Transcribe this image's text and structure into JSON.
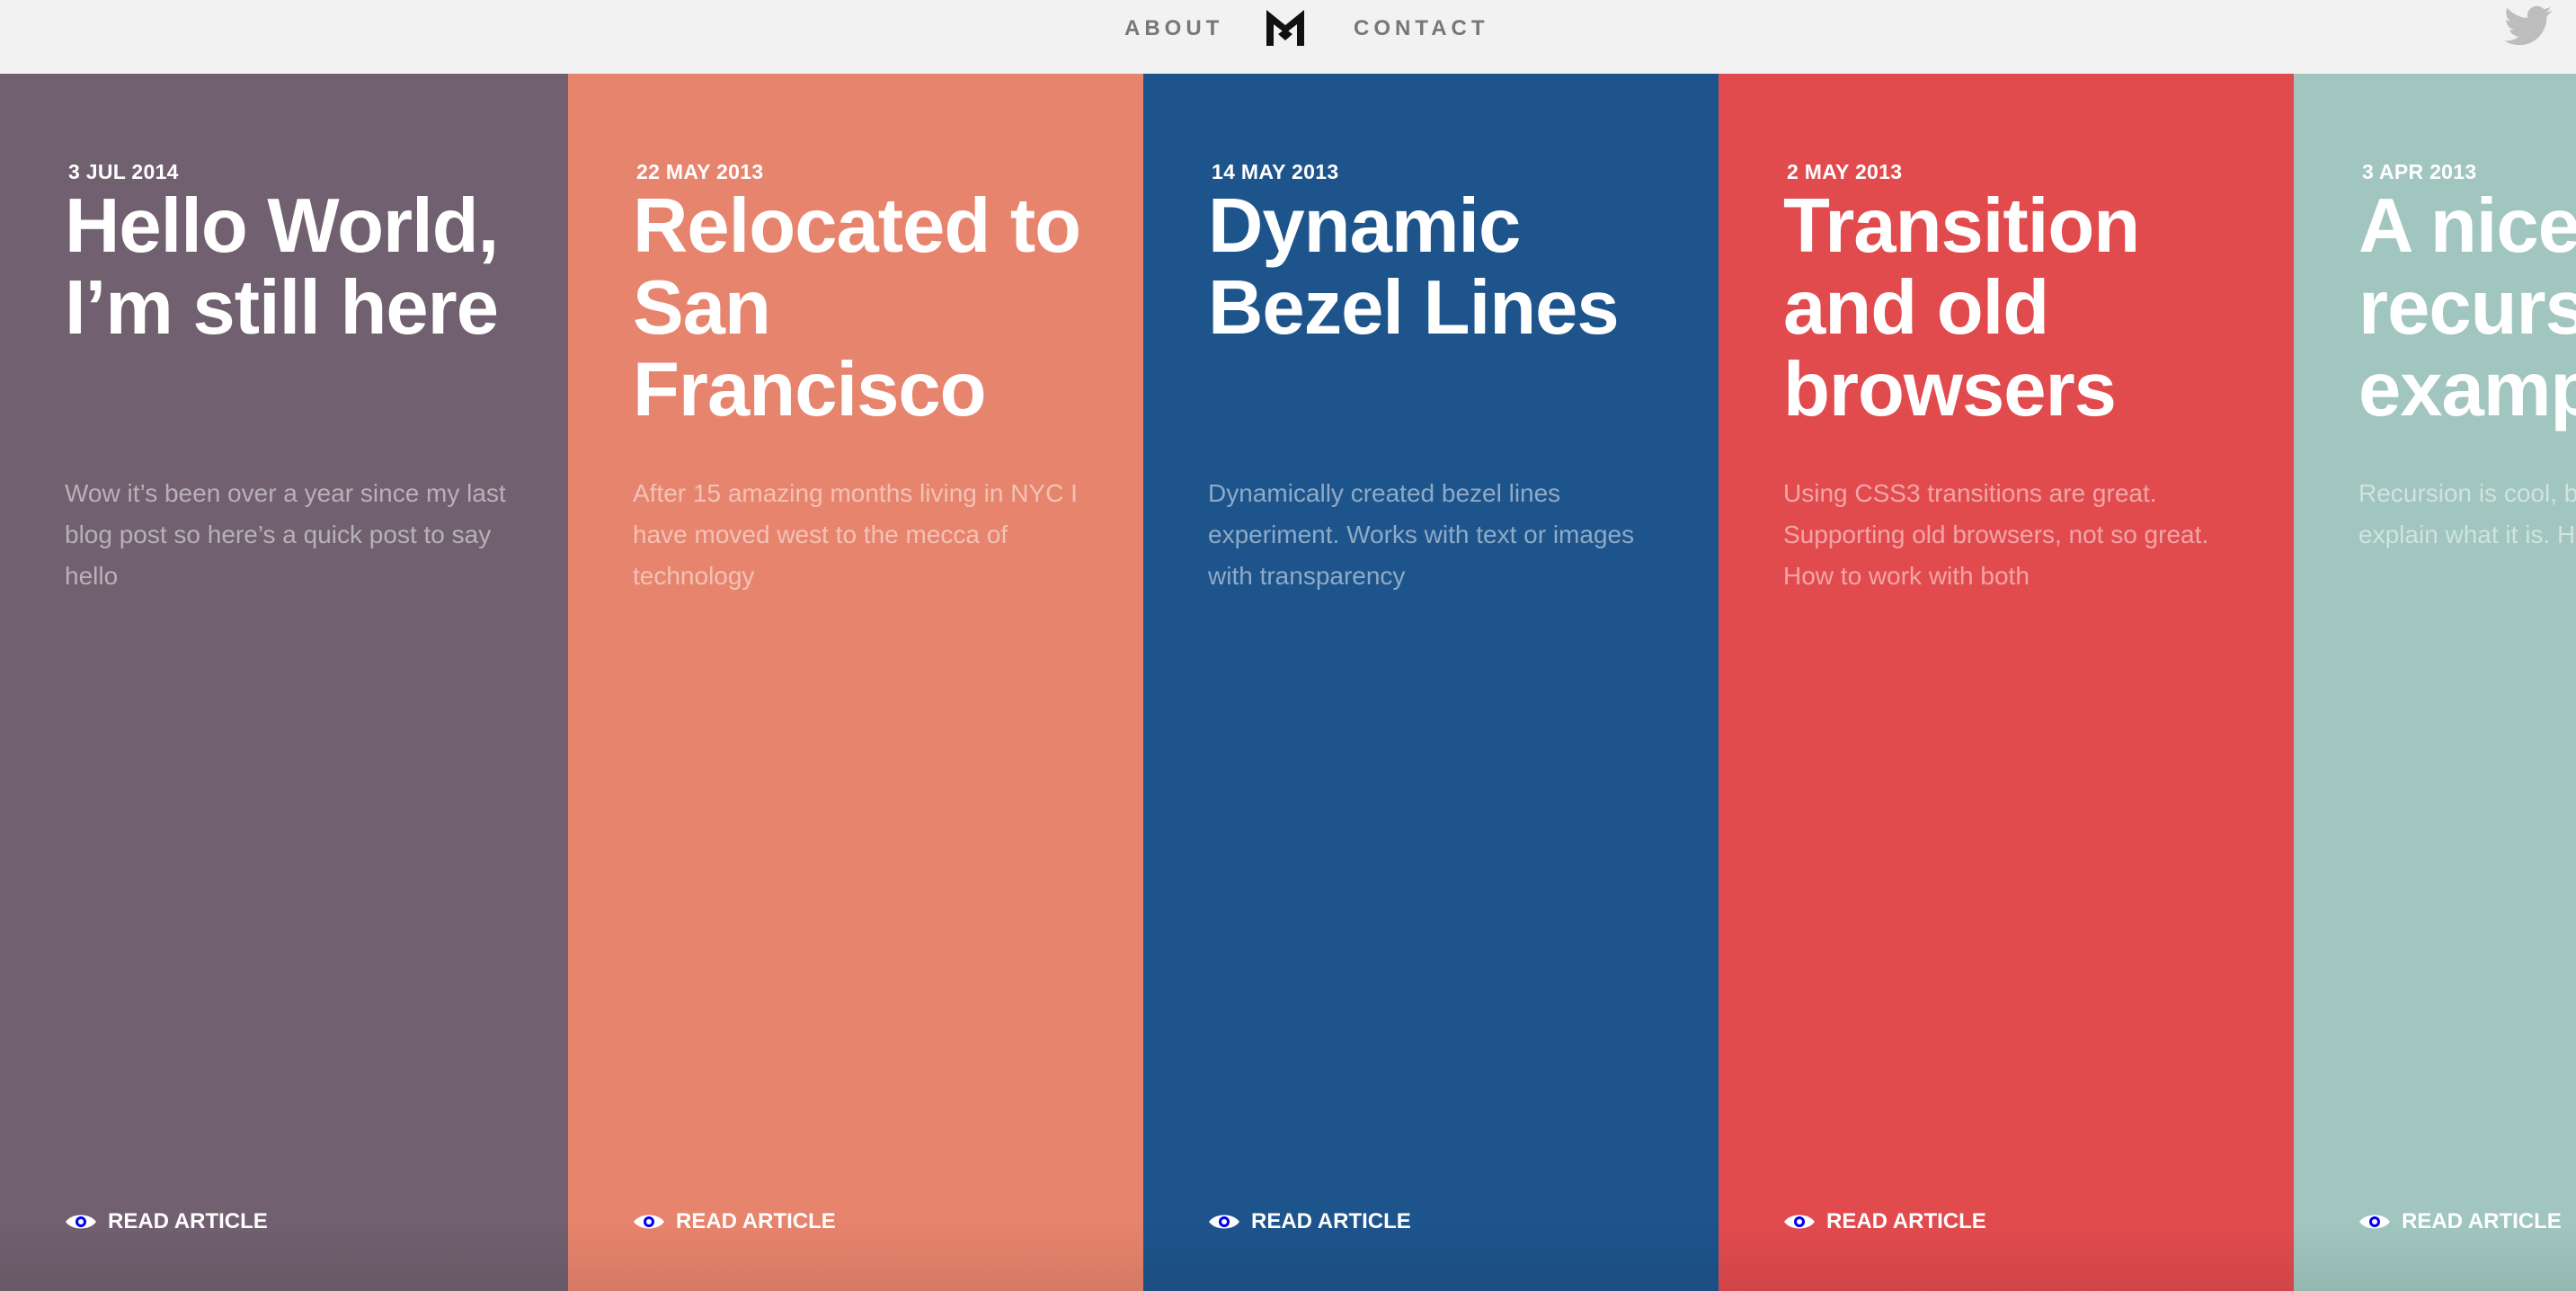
{
  "nav": {
    "about_label": "ABOUT",
    "contact_label": "CONTACT",
    "logo_icon": "m-monogram-icon",
    "twitter_icon": "twitter-bird-icon"
  },
  "cards": [
    {
      "date": "3 JUL 2014",
      "title": "Hello World, I’m still here",
      "excerpt": "Wow it’s been over a year since my last blog post so here’s a quick post to say hello",
      "cta": "READ ARTICLE",
      "color": "#71606f"
    },
    {
      "date": "22 MAY 2013",
      "title": "Relocated to San Francisco",
      "excerpt": "After 15 amazing months living in NYC I have moved west to the mecca of technology",
      "cta": "READ ARTICLE",
      "color": "#e7846d"
    },
    {
      "date": "14 MAY 2013",
      "title": "Dynamic Bezel Lines",
      "excerpt": "Dynamically created bezel lines experiment. Works with text or images with transparency",
      "cta": "READ ARTICLE",
      "color": "#1d548c"
    },
    {
      "date": "2 MAY 2013",
      "title": "Transition and old browsers",
      "excerpt": "Using CSS3 transitions are great. Supporting old browsers, not so great. How to work with both",
      "cta": "READ ARTICLE",
      "color": "#e24b4e"
    },
    {
      "date": "3 APR 2013",
      "title": "A nice recursive example",
      "excerpt": "Recursion is cool, but can be hard to explain what it is. Here is an example",
      "cta": "READ ARTICLE",
      "color": "#a1c6bf"
    }
  ]
}
